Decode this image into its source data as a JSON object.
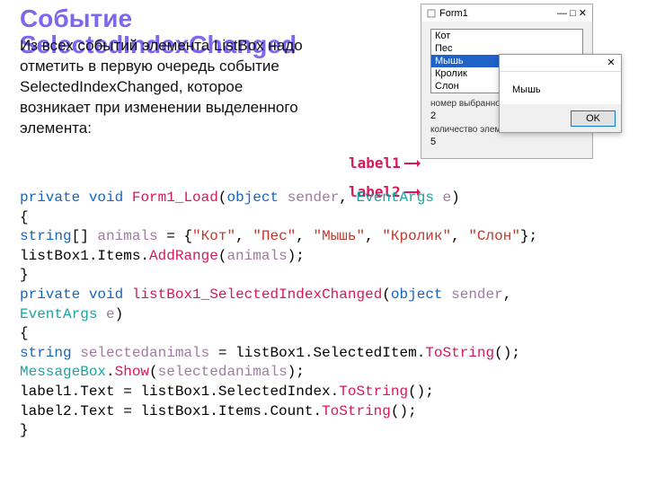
{
  "title_line1": "Событие",
  "title_line2": "SelectedIndexChanged",
  "intro": "Из всех событий элемента ListBox надо отметить в первую очередь событие SelectedIndexChanged, которое возникает при изменении выделенного элемента:",
  "arrow1": "label1",
  "arrow2": "label2",
  "form": {
    "title": "Form1",
    "items": [
      "Кот",
      "Пес",
      "Мышь",
      "Кролик",
      "Слон"
    ],
    "selected_index": 2,
    "label_idx_caption": "номер выбранного элемента:",
    "label_idx_value": "2",
    "label_cnt_caption": "количество элементов в списке:",
    "label_cnt_value": "5"
  },
  "msgbox": {
    "text": "Мышь",
    "ok": "OK"
  },
  "code": {
    "l1_private": "private",
    "l1_void": "void",
    "l1_m": "Form1_Load",
    "l1_obj": "object",
    "l1_sender": "sender",
    "l1_evt": "EventArgs",
    "l1_e": "e",
    "l2": "{",
    "l3_string": "string",
    "l3_arr": "[]",
    "l3_var": "animals",
    "l3_eq": " = {",
    "l3_s1": "\"Кот\"",
    "l3_s2": "\"Пес\"",
    "l3_s3": "\"Мышь\"",
    "l3_s4": "\"Кролик\"",
    "l3_s5": "\"Слон\"",
    "l3_end": "};",
    "l4_a": "listBox1.Items.",
    "l4_m": "AddRange",
    "l4_b": "(",
    "l4_v": "animals",
    "l4_c": ");",
    "l5": "}",
    "l6_private": "private",
    "l6_void": "void",
    "l6_m": "listBox1_SelectedIndexChanged",
    "l6_obj": "object",
    "l6_sender": "sender",
    "l7_evt": "EventArgs",
    "l7_e": "e",
    "l8": "{",
    "l9_string": "string",
    "l9_v": "selectedanimals",
    "l9_rest": " = listBox1.SelectedItem.",
    "l9_ts": "ToString",
    "l9_end": "();",
    "l10_cls": "MessageBox",
    "l10_dot": ".",
    "l10_m": "Show",
    "l10_a": "(",
    "l10_v": "selectedanimals",
    "l10_b": ");",
    "l11_a": "label1.Text = listBox1.SelectedIndex.",
    "l11_ts": "ToString",
    "l11_b": "();",
    "l12_a": "label2.Text = listBox1.Items.Count.",
    "l12_ts": "ToString",
    "l12_b": "();",
    "l13": "}"
  }
}
